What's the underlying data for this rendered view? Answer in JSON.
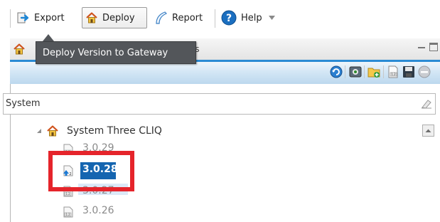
{
  "toolbar": {
    "export_label": "Export",
    "deploy_label": "Deploy",
    "report_label": "Report",
    "help_label": "Help"
  },
  "tooltip": {
    "text": "Deploy Version to Gateway"
  },
  "tabs": {
    "partial_text": "as"
  },
  "search": {
    "value": "System"
  },
  "tree": {
    "system_label": "System Three CLIQ",
    "versions": [
      {
        "label": "3.0.29",
        "state": "normal"
      },
      {
        "label": "3.0.28",
        "state": "selected"
      },
      {
        "label": "3.0.27",
        "state": "highlighted"
      },
      {
        "label": "3.0.26",
        "state": "normal"
      }
    ]
  },
  "colors": {
    "accent_blue": "#2a8bd4",
    "selection": "#1565b0",
    "callout_red": "#e5242b",
    "tooltip_bg": "#53565a"
  }
}
